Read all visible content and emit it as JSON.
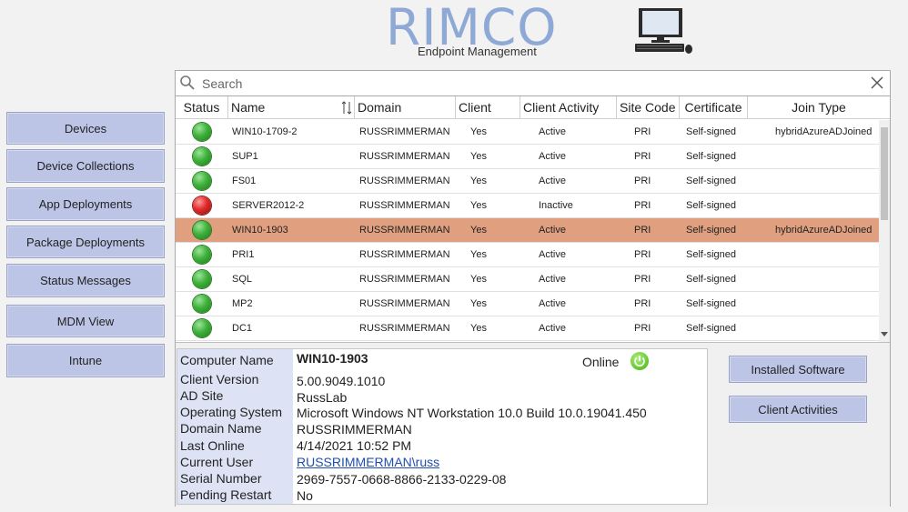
{
  "header": {
    "logo_title": "RIMCO",
    "logo_subtitle": "Endpoint Management",
    "computer_icon": "desktop-computer-icon"
  },
  "sidebar": {
    "items": [
      {
        "label": "Devices"
      },
      {
        "label": "Device Collections"
      },
      {
        "label": "App Deployments"
      },
      {
        "label": "Package Deployments"
      },
      {
        "label": "Status Messages"
      },
      {
        "label": "MDM View"
      },
      {
        "label": "Intune"
      }
    ]
  },
  "search": {
    "placeholder": "Search",
    "value": ""
  },
  "table": {
    "columns": [
      "Status",
      "Name",
      "Domain",
      "Client",
      "Client Activity",
      "Site Code",
      "Certificate",
      "Join Type"
    ],
    "rows": [
      {
        "status": "green",
        "name": "WIN10-1709-2",
        "domain": "RUSSRIMMERMAN",
        "client": "Yes",
        "activity": "Active",
        "site": "PRI",
        "cert": "Self-signed",
        "join": "hybridAzureADJoined",
        "selected": false
      },
      {
        "status": "green",
        "name": "SUP1",
        "domain": "RUSSRIMMERMAN",
        "client": "Yes",
        "activity": "Active",
        "site": "PRI",
        "cert": "Self-signed",
        "join": "",
        "selected": false
      },
      {
        "status": "green",
        "name": "FS01",
        "domain": "RUSSRIMMERMAN",
        "client": "Yes",
        "activity": "Active",
        "site": "PRI",
        "cert": "Self-signed",
        "join": "",
        "selected": false
      },
      {
        "status": "red",
        "name": "SERVER2012-2",
        "domain": "RUSSRIMMERMAN",
        "client": "Yes",
        "activity": "Inactive",
        "site": "PRI",
        "cert": "Self-signed",
        "join": "",
        "selected": false
      },
      {
        "status": "green",
        "name": "WIN10-1903",
        "domain": "RUSSRIMMERMAN",
        "client": "Yes",
        "activity": "Active",
        "site": "PRI",
        "cert": "Self-signed",
        "join": "hybridAzureADJoined",
        "selected": true
      },
      {
        "status": "green",
        "name": "PRI1",
        "domain": "RUSSRIMMERMAN",
        "client": "Yes",
        "activity": "Active",
        "site": "PRI",
        "cert": "Self-signed",
        "join": "",
        "selected": false
      },
      {
        "status": "green",
        "name": "SQL",
        "domain": "RUSSRIMMERMAN",
        "client": "Yes",
        "activity": "Active",
        "site": "PRI",
        "cert": "Self-signed",
        "join": "",
        "selected": false
      },
      {
        "status": "green",
        "name": "MP2",
        "domain": "RUSSRIMMERMAN",
        "client": "Yes",
        "activity": "Active",
        "site": "PRI",
        "cert": "Self-signed",
        "join": "",
        "selected": false
      },
      {
        "status": "green",
        "name": "DC1",
        "domain": "RUSSRIMMERMAN",
        "client": "Yes",
        "activity": "Active",
        "site": "PRI",
        "cert": "Self-signed",
        "join": "",
        "selected": false
      }
    ]
  },
  "details": {
    "computer_name_label": "Computer Name",
    "computer_name": "WIN10-1903",
    "online_label": "Online",
    "client_version_label": "Client Version",
    "client_version": "5.00.9049.1010",
    "ad_site_label": "AD Site",
    "ad_site": "RussLab",
    "os_label": "Operating System",
    "os": "Microsoft Windows NT Workstation 10.0 Build 10.0.19041.450",
    "domain_label": "Domain Name",
    "domain": "RUSSRIMMERMAN",
    "last_online_label": "Last Online",
    "last_online": "4/14/2021 10:52 PM",
    "current_user_label": "Current User",
    "current_user": "RUSSRIMMERMAN\\russ",
    "serial_label": "Serial Number",
    "serial": "2969-7557-0668-8866-2133-0229-08",
    "pending_restart_label": "Pending Restart",
    "pending_restart": "No"
  },
  "actions": {
    "installed_software": "Installed Software",
    "client_activities": "Client Activities"
  },
  "colors": {
    "button_fill": "#bcc5e6",
    "selected_row": "#e0a07f",
    "status_active": "#3fb23b",
    "status_inactive": "#e02a2a",
    "logo": "#8fa9d6"
  }
}
